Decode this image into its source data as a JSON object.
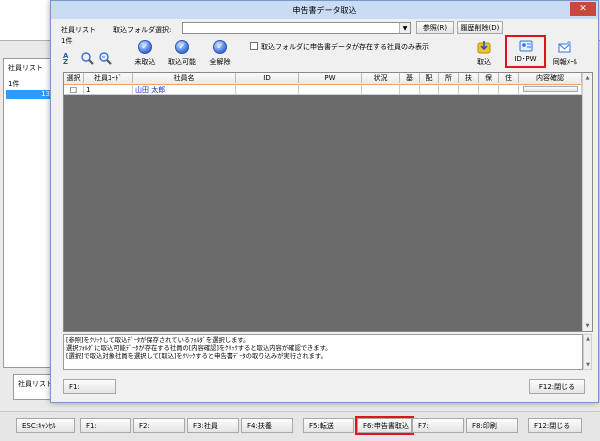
{
  "background_window": {
    "panel_title": "社員リスト",
    "count": "1件",
    "selected_row_num": "13",
    "status_label": "社員リストで"
  },
  "fkeys": [
    {
      "label": "ESC:ｷｬﾝｾﾙ"
    },
    {
      "label": "F1:"
    },
    {
      "label": "F2:"
    },
    {
      "label": "F3:社員"
    },
    {
      "label": "F4:扶養"
    },
    {
      "label": "F5:転送"
    },
    {
      "label": "F6:申告書取込"
    },
    {
      "label": "F7:"
    },
    {
      "label": "F8:印刷"
    },
    {
      "label": "F12:閉じる"
    }
  ],
  "dialog": {
    "title": "申告書データ取込",
    "close_glyph": "✕",
    "list_label": "社員リスト",
    "folder_label": "取込フォルダ選択:",
    "folder_value": "",
    "browse_button": "参照(R)",
    "history_button": "履歴削除(D)",
    "count": "1件",
    "filter_checkbox_label": "取込フォルダに申告書データが存在する社員のみ表示",
    "tools": {
      "not_imported": "未取込",
      "importable": "取込可能",
      "clear_all": "全解除",
      "import": "取込",
      "id_pw": "ID･PW",
      "bulk_mail": "同報ﾒｰﾙ"
    },
    "table": {
      "columns": [
        "選択",
        "社員ｺｰﾄﾞ",
        "社員名",
        "ID",
        "PW",
        "状況",
        "基",
        "配",
        "所",
        "扶",
        "保",
        "住",
        "内容確認"
      ],
      "rows": [
        {
          "check": "☐",
          "code": "1",
          "name": "山田 太郎",
          "id": "",
          "pw": "",
          "status": "",
          "ki": "",
          "hai": "",
          "sho": "",
          "fu": "",
          "ho": "",
          "ju": ""
        }
      ]
    },
    "messages": [
      "[参照]をｸﾘｯｸして取込ﾃﾞｰﾀが保存されているﾌｫﾙﾀﾞを選択します。",
      "選択ﾌｫﾙﾀﾞに取込可能ﾃﾞｰﾀが存在する社員の[内容確認]をｸﾘｯｸすると取込内容が確認できます。",
      "[選択]で取込対象社員を選択して[取込]をｸﾘｯｸすると申告書ﾃﾞｰﾀの取り込みが実行されます。"
    ],
    "f1_button": "F1:",
    "f12_button": "F12:閉じる"
  },
  "colors": {
    "titlebar": "#c9dcf4",
    "grid_bg": "#6b6b6b",
    "close_red": "#c7493a",
    "highlight": "#e0141e",
    "selection_blue": "#3399ff"
  }
}
